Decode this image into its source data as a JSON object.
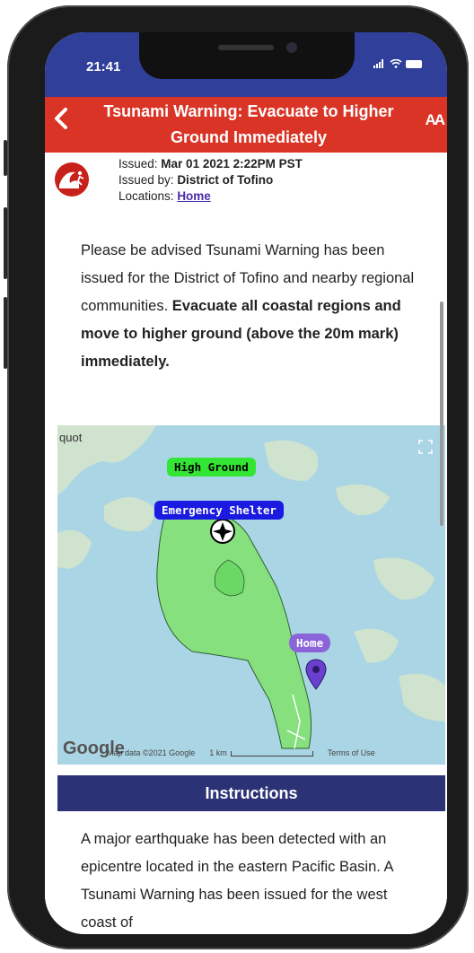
{
  "status_bar": {
    "time": "21:41"
  },
  "alert": {
    "back_icon": "chevron-left-icon",
    "title": "Tsunami Warning: Evacuate to Higher Ground Immediately",
    "font_size_label": "AA",
    "color": "#d93425"
  },
  "meta": {
    "issued_label": "Issued:",
    "issued_value": "Mar 01 2021 2:22PM PST",
    "issued_by_label": "Issued by:",
    "issued_by_value": "District of Tofino",
    "locations_label": "Locations:",
    "locations_value": "Home"
  },
  "body": {
    "paragraph_plain": "Please be advised Tsunami Warning has been issued for the District of Tofino and nearby regional communities. ",
    "paragraph_bold": "Evacuate all coastal regions and move to higher ground (above the 20m mark) immediately."
  },
  "map": {
    "place_label": "quot",
    "markers": {
      "high_ground": "High Ground",
      "shelter": "Emergency Shelter",
      "home": "Home"
    },
    "google_logo": "Google",
    "map_data": "Map data ©2021 Google",
    "scale": "1 km",
    "terms": "Terms of Use"
  },
  "instructions": {
    "header": "Instructions",
    "text": "A major earthquake has been detected with an epicentre located in the eastern Pacific Basin. A Tsunami Warning has been issued for the west coast of"
  }
}
